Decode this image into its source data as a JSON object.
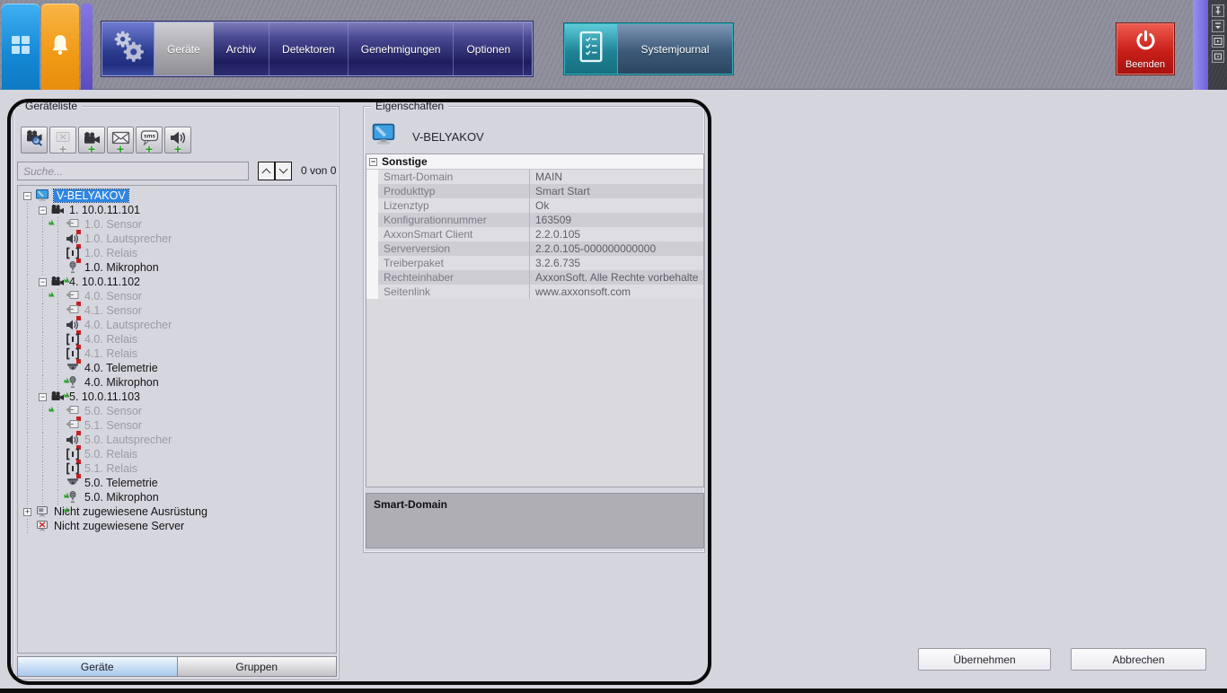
{
  "topbar": {
    "side_tabs": [
      {
        "id": "apps",
        "icon": "grid"
      },
      {
        "id": "alarms",
        "icon": "bell"
      }
    ],
    "settings_icon": "gears",
    "tabs": [
      {
        "id": "geraete",
        "label": "Geräte"
      },
      {
        "id": "archiv",
        "label": "Archiv"
      },
      {
        "id": "detektoren",
        "label": "Detektoren"
      },
      {
        "id": "genehmigungen",
        "label": "Genehmigungen"
      },
      {
        "id": "optionen",
        "label": "Optionen"
      }
    ],
    "active_tab": "geraete",
    "systemjournal_label": "Systemjournal",
    "beenden_label": "Beenden",
    "dock_icons": [
      "pin",
      "collapse",
      "panel-right",
      "panel-small"
    ]
  },
  "device_panel": {
    "title": "Geräteliste",
    "toolbar_buttons": [
      {
        "name": "search-devices",
        "icon": "camera-search",
        "plus": false,
        "disabled": false
      },
      {
        "name": "add-unassigned",
        "icon": "box-x",
        "plus": true,
        "disabled": true
      },
      {
        "name": "add-camera",
        "icon": "camera-lg",
        "plus": true,
        "disabled": false
      },
      {
        "name": "add-email",
        "icon": "mail",
        "plus": true,
        "disabled": false
      },
      {
        "name": "add-sms",
        "icon": "sms",
        "plus": true,
        "disabled": false,
        "badge": "sms"
      },
      {
        "name": "add-speaker",
        "icon": "speaker-lg",
        "plus": true,
        "disabled": false
      }
    ],
    "search": {
      "placeholder": "Suche...",
      "counter": "0 von 0"
    },
    "tree": [
      {
        "depth": 0,
        "expander": "minus",
        "icon": "monitor",
        "label": "V-BELYAKOV",
        "state": "selected",
        "marker": null
      },
      {
        "depth": 1,
        "expander": "minus",
        "icon": "camera",
        "label": "1. 10.0.11.101",
        "state": "normal",
        "marker": "green"
      },
      {
        "depth": 2,
        "expander": null,
        "icon": "sensor",
        "label": "1.0. Sensor",
        "state": "disabled",
        "marker": "red"
      },
      {
        "depth": 2,
        "expander": null,
        "icon": "speaker",
        "label": "1.0. Lautsprecher",
        "state": "disabled",
        "marker": "red"
      },
      {
        "depth": 2,
        "expander": null,
        "icon": "relay",
        "label": "1.0. Relais",
        "state": "disabled",
        "marker": "red"
      },
      {
        "depth": 2,
        "expander": null,
        "icon": "microphone",
        "label": "1.0. Mikrophon",
        "state": "normal",
        "marker": "green"
      },
      {
        "depth": 1,
        "expander": "minus",
        "icon": "camera",
        "label": "4. 10.0.11.102",
        "state": "normal",
        "marker": "green"
      },
      {
        "depth": 2,
        "expander": null,
        "icon": "sensor",
        "label": "4.0. Sensor",
        "state": "disabled",
        "marker": "red"
      },
      {
        "depth": 2,
        "expander": null,
        "icon": "sensor",
        "label": "4.1. Sensor",
        "state": "disabled",
        "marker": "red"
      },
      {
        "depth": 2,
        "expander": null,
        "icon": "speaker",
        "label": "4.0. Lautsprecher",
        "state": "disabled",
        "marker": "red"
      },
      {
        "depth": 2,
        "expander": null,
        "icon": "relay",
        "label": "4.0. Relais",
        "state": "disabled",
        "marker": "red"
      },
      {
        "depth": 2,
        "expander": null,
        "icon": "relay",
        "label": "4.1. Relais",
        "state": "disabled",
        "marker": "red"
      },
      {
        "depth": 2,
        "expander": null,
        "icon": "telemetry",
        "label": "4.0. Telemetrie",
        "state": "normal",
        "marker": "green"
      },
      {
        "depth": 2,
        "expander": null,
        "icon": "microphone",
        "label": "4.0. Mikrophon",
        "state": "normal",
        "marker": "green"
      },
      {
        "depth": 1,
        "expander": "minus",
        "icon": "camera",
        "label": "5. 10.0.11.103",
        "state": "normal",
        "marker": "green"
      },
      {
        "depth": 2,
        "expander": null,
        "icon": "sensor",
        "label": "5.0. Sensor",
        "state": "disabled",
        "marker": "red"
      },
      {
        "depth": 2,
        "expander": null,
        "icon": "sensor",
        "label": "5.1. Sensor",
        "state": "disabled",
        "marker": "red"
      },
      {
        "depth": 2,
        "expander": null,
        "icon": "speaker",
        "label": "5.0. Lautsprecher",
        "state": "disabled",
        "marker": "red"
      },
      {
        "depth": 2,
        "expander": null,
        "icon": "relay",
        "label": "5.0. Relais",
        "state": "disabled",
        "marker": "red"
      },
      {
        "depth": 2,
        "expander": null,
        "icon": "relay",
        "label": "5.1. Relais",
        "state": "disabled",
        "marker": "red"
      },
      {
        "depth": 2,
        "expander": null,
        "icon": "telemetry",
        "label": "5.0. Telemetrie",
        "state": "normal",
        "marker": "green"
      },
      {
        "depth": 2,
        "expander": null,
        "icon": "microphone",
        "label": "5.0. Mikrophon",
        "state": "normal",
        "marker": "green"
      },
      {
        "depth": 0,
        "expander": "plus",
        "icon": "equipment",
        "label": "Nicht zugewiesene Ausrüstung",
        "state": "normal",
        "marker": null
      },
      {
        "depth": 0,
        "expander": null,
        "icon": "server-x",
        "label": "Nicht zugewiesene Server",
        "state": "normal",
        "marker": null
      }
    ],
    "bottom_tabs": [
      {
        "id": "geraete",
        "label": "Geräte",
        "active": true
      },
      {
        "id": "gruppen",
        "label": "Gruppen",
        "active": false
      }
    ]
  },
  "properties_panel": {
    "title": "Eigenschaften",
    "object_name": "V-BELYAKOV",
    "object_icon": "monitor",
    "group_label": "Sonstige",
    "rows": [
      {
        "label": "Smart-Domain",
        "value": "MAIN"
      },
      {
        "label": "Produkttyp",
        "value": "Smart Start"
      },
      {
        "label": "Lizenztyp",
        "value": "Ok"
      },
      {
        "label": "Konfigurationnummer",
        "value": "163509"
      },
      {
        "label": "AxxonSmart Client",
        "value": "2.2.0.105"
      },
      {
        "label": "Serverversion",
        "value": "2.2.0.105-000000000000"
      },
      {
        "label": "Treiberpaket",
        "value": "3.2.6.735"
      },
      {
        "label": "Rechteinhaber",
        "value": "AxxonSoft. Alle Rechte vorbehalte"
      },
      {
        "label": "Seitenlink",
        "value": "www.axxonsoft.com"
      }
    ],
    "description": "Smart-Domain"
  },
  "footer": {
    "apply_label": "Übernehmen",
    "cancel_label": "Abbrechen"
  },
  "colors": {
    "selection_blue": "#2f86e0",
    "tab_bar_navy": "#23236b",
    "journal_teal": "#2fa9bd",
    "beenden_red": "#c42a24",
    "alarm_orange": "#f5a42a",
    "apps_blue": "#1b97e0"
  }
}
